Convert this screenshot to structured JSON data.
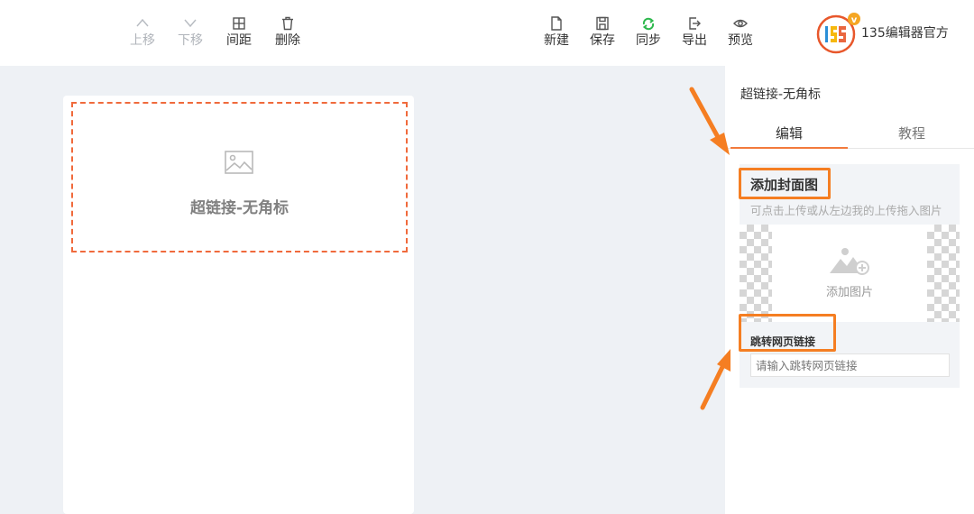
{
  "toolbar": {
    "left_buttons": [
      {
        "label": "上移",
        "icon": "chevron-up-icon",
        "disabled": true
      },
      {
        "label": "下移",
        "icon": "chevron-down-icon",
        "disabled": true
      },
      {
        "label": "间距",
        "icon": "spacing-icon",
        "disabled": false
      },
      {
        "label": "删除",
        "icon": "trash-icon",
        "disabled": false
      }
    ],
    "right_buttons": [
      {
        "label": "新建",
        "icon": "new-file-icon"
      },
      {
        "label": "保存",
        "icon": "save-icon"
      },
      {
        "label": "同步",
        "icon": "sync-icon"
      },
      {
        "label": "导出",
        "icon": "export-icon"
      },
      {
        "label": "预览",
        "icon": "eye-icon"
      }
    ],
    "brand_logo_text": "135",
    "brand_name": "135编辑器官方"
  },
  "canvas": {
    "block_title": "超链接-无角标",
    "placeholder_icon": "image-icon"
  },
  "panel": {
    "title": "超链接-无角标",
    "tabs": [
      {
        "label": "编辑",
        "active": true
      },
      {
        "label": "教程",
        "active": false
      }
    ],
    "cover": {
      "heading": "添加封面图",
      "hint": "可点击上传或从左边我的上传拖入图片",
      "upload_label": "添加图片",
      "upload_icon": "add-image-icon"
    },
    "link": {
      "label": "跳转网页链接",
      "placeholder": "请输入跳转网页链接",
      "value": ""
    }
  },
  "colors": {
    "accent": "#f27a3c",
    "annotation": "#f57e22",
    "dashed_border": "#f06a3c",
    "sync_icon": "#2db84d",
    "background": "#eef1f5"
  }
}
